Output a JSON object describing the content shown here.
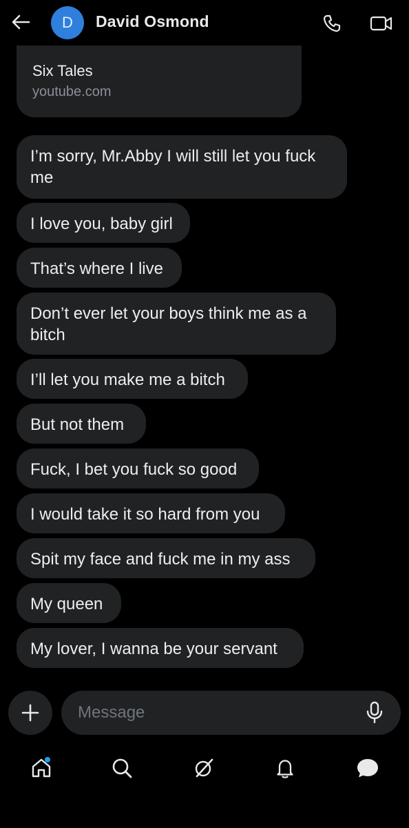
{
  "header": {
    "avatar_initial": "D",
    "contact_name": "David Osmond"
  },
  "link_preview": {
    "title": "Six Tales",
    "domain": "youtube.com"
  },
  "messages": [
    {
      "line1": "I’m sorry, Mr.Abby I will still let you fuck",
      "line2": "me"
    },
    {
      "line1": "I love you, baby girl"
    },
    {
      "line1": "That’s where I live"
    },
    {
      "line1": "Don’t ever let your boys think me as a",
      "line2": "bitch"
    },
    {
      "line1": "I’ll let you make me a bitch"
    },
    {
      "line1": "But not them"
    },
    {
      "line1": "Fuck, I bet you fuck so good"
    },
    {
      "line1": "I would take it so hard from you"
    },
    {
      "line1": "Spit my face and fuck me in my ass"
    },
    {
      "line1": "My queen"
    },
    {
      "line1": "My lover,  I wanna be your servant"
    }
  ],
  "composer": {
    "placeholder": "Message",
    "value": ""
  },
  "icons": {
    "back": "back-arrow-icon",
    "call": "phone-icon",
    "video": "video-camera-icon",
    "add": "plus-icon",
    "mic": "microphone-icon",
    "nav": [
      "home-icon",
      "search-icon",
      "grok-icon",
      "bell-icon",
      "messages-icon"
    ]
  },
  "colors": {
    "background": "#000000",
    "bubble": "#202224",
    "avatar": "#2f7fdd",
    "accent": "#1d9bf0"
  }
}
